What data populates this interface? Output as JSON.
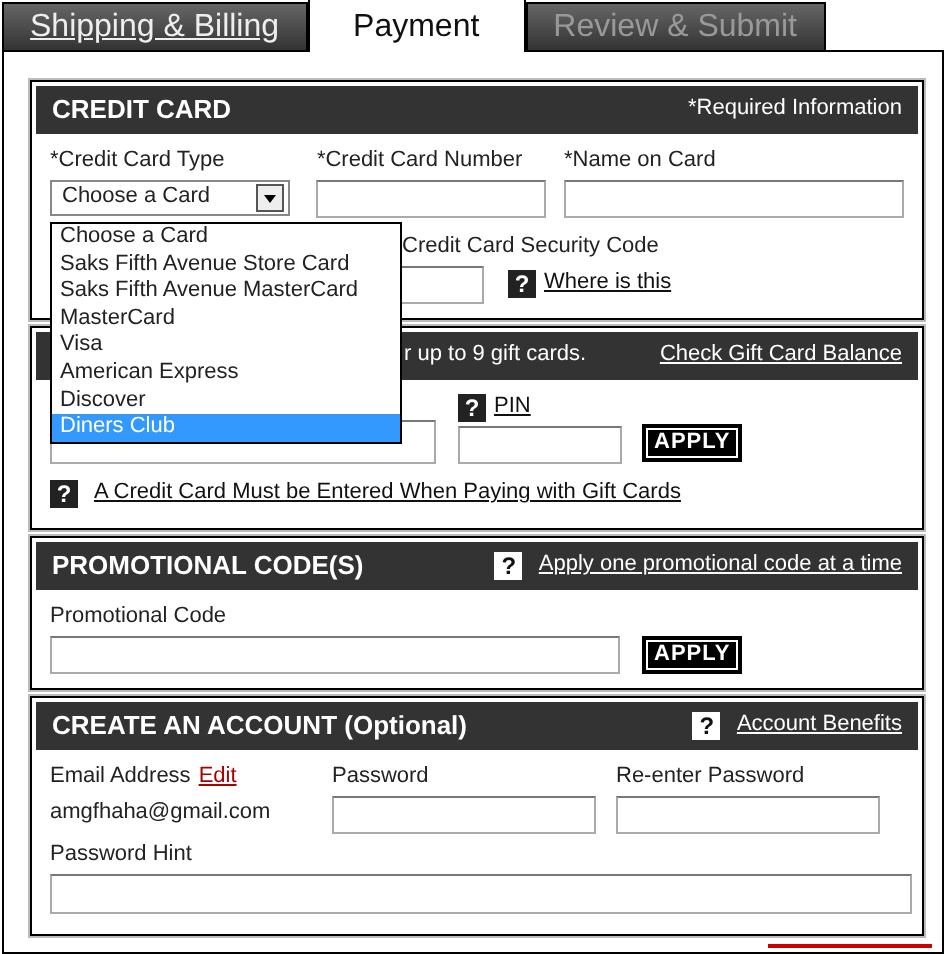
{
  "tabs": [
    {
      "label": "Shipping & Billing",
      "selected": false,
      "disabled": false
    },
    {
      "label": "Payment",
      "selected": true,
      "disabled": false
    },
    {
      "label": "Review & Submit",
      "selected": false,
      "disabled": true
    }
  ],
  "credit_card": {
    "title": "CREDIT CARD",
    "required_note": "*Required Information",
    "fields": [
      {
        "label": "*Credit Card Type",
        "kind": "select",
        "value": "Choose a Card"
      },
      {
        "label": "*Credit Card Number",
        "kind": "text"
      },
      {
        "label": "*Name on Card",
        "kind": "text"
      }
    ],
    "security_label": "Credit Card Security Code",
    "security_help_icon": "?",
    "security_help_link": "Where is this",
    "dropdown_options": [
      {
        "label": "Choose a Card",
        "selected": false
      },
      {
        "label": "Saks Fifth Avenue Store Card",
        "selected": false
      },
      {
        "label": "Saks Fifth Avenue MasterCard",
        "selected": false
      },
      {
        "label": "MasterCard",
        "selected": false
      },
      {
        "label": "Visa",
        "selected": false
      },
      {
        "label": "American Express",
        "selected": false
      },
      {
        "label": "Discover",
        "selected": false
      },
      {
        "label": "Diners Club",
        "selected": true
      }
    ]
  },
  "gift_cards": {
    "header_text": "r up to 9 gift cards.",
    "balance_link": "Check Gift Card Balance",
    "pin_help_icon": "?",
    "pin_link": "PIN",
    "apply_button": "APPLY",
    "note_help_icon": "?",
    "note_link": "A Credit Card Must be Entered When Paying with Gift Cards"
  },
  "promo": {
    "title": "PROMOTIONAL CODE(S)",
    "help_icon": "?",
    "help_link": "Apply one promotional code at a time",
    "field_label": "Promotional Code",
    "apply_button": "APPLY"
  },
  "account": {
    "title": "CREATE AN ACCOUNT (Optional)",
    "help_icon": "?",
    "help_link": "Account Benefits",
    "email_label": "Email Address",
    "edit_link": "Edit",
    "email": "amgfhaha@gmail.com",
    "password_label": "Password",
    "reenter_label": "Re-enter Password",
    "hint_label": "Password Hint"
  }
}
